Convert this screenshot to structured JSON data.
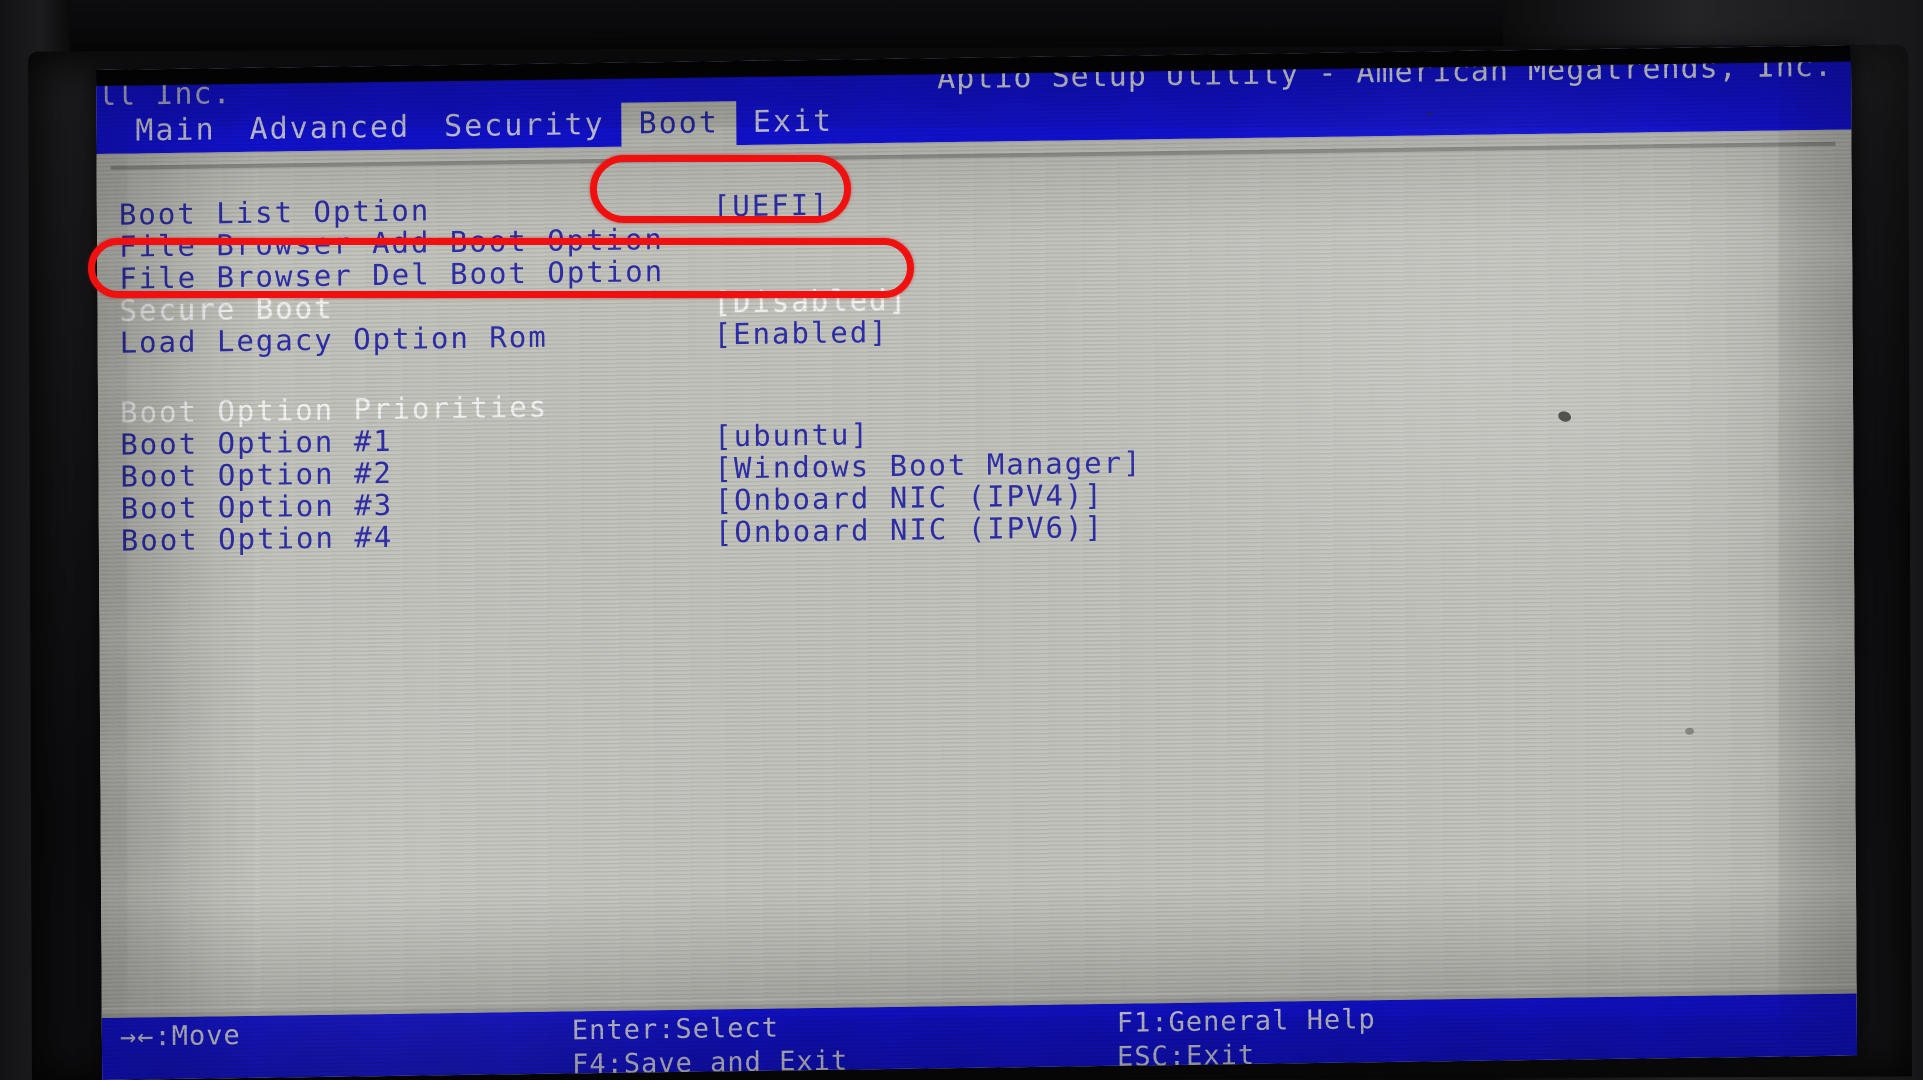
{
  "screen": {
    "title_main": "Aptio Setup Utility - American Megatrends, Inc.",
    "title_ghost": "ll Inc.",
    "menu": [
      {
        "label": "Main",
        "active": false
      },
      {
        "label": "Advanced",
        "active": false
      },
      {
        "label": "Security",
        "active": false
      },
      {
        "label": "Boot",
        "active": true
      },
      {
        "label": "Exit",
        "active": false
      }
    ],
    "settings": [
      {
        "label": "Boot List Option",
        "value": "[UEFI]",
        "selected": false
      },
      {
        "label": "File Browser Add Boot Option",
        "value": "",
        "selected": false
      },
      {
        "label": "File Browser Del Boot Option",
        "value": "",
        "selected": false
      },
      {
        "label": "Secure Boot",
        "value": "[Disabled]",
        "selected": true
      },
      {
        "label": "Load Legacy Option Rom",
        "value": "[Enabled]",
        "selected": false
      }
    ],
    "priorities_header": "Boot Option Priorities",
    "priorities": [
      {
        "label": "Boot Option #1",
        "value": "[ubuntu]"
      },
      {
        "label": "Boot Option #2",
        "value": "[Windows Boot Manager]"
      },
      {
        "label": "Boot Option #3",
        "value": "[Onboard NIC (IPV4)]"
      },
      {
        "label": "Boot Option #4",
        "value": "[Onboard NIC (IPV6)]"
      }
    ],
    "footer": {
      "move": "→←:Move",
      "select": "Enter:Select",
      "help": "F1:General Help",
      "save_exit": "F4:Save and Exit",
      "esc_exit": "ESC:Exit"
    }
  },
  "annotations": [
    {
      "name": "uefi-highlight",
      "target": "[UEFI]",
      "color": "#f01010"
    },
    {
      "name": "secure-boot-highlight",
      "target": "Secure Boot [Disabled]",
      "color": "#f01010"
    }
  ],
  "colors": {
    "bios_background": "#c3c3bd",
    "bios_blue_bar": "#1414e6",
    "bios_text_blue": "#2e2ea8",
    "bios_text_selected": "#f2f2f2",
    "annotation_red": "#f01010"
  }
}
